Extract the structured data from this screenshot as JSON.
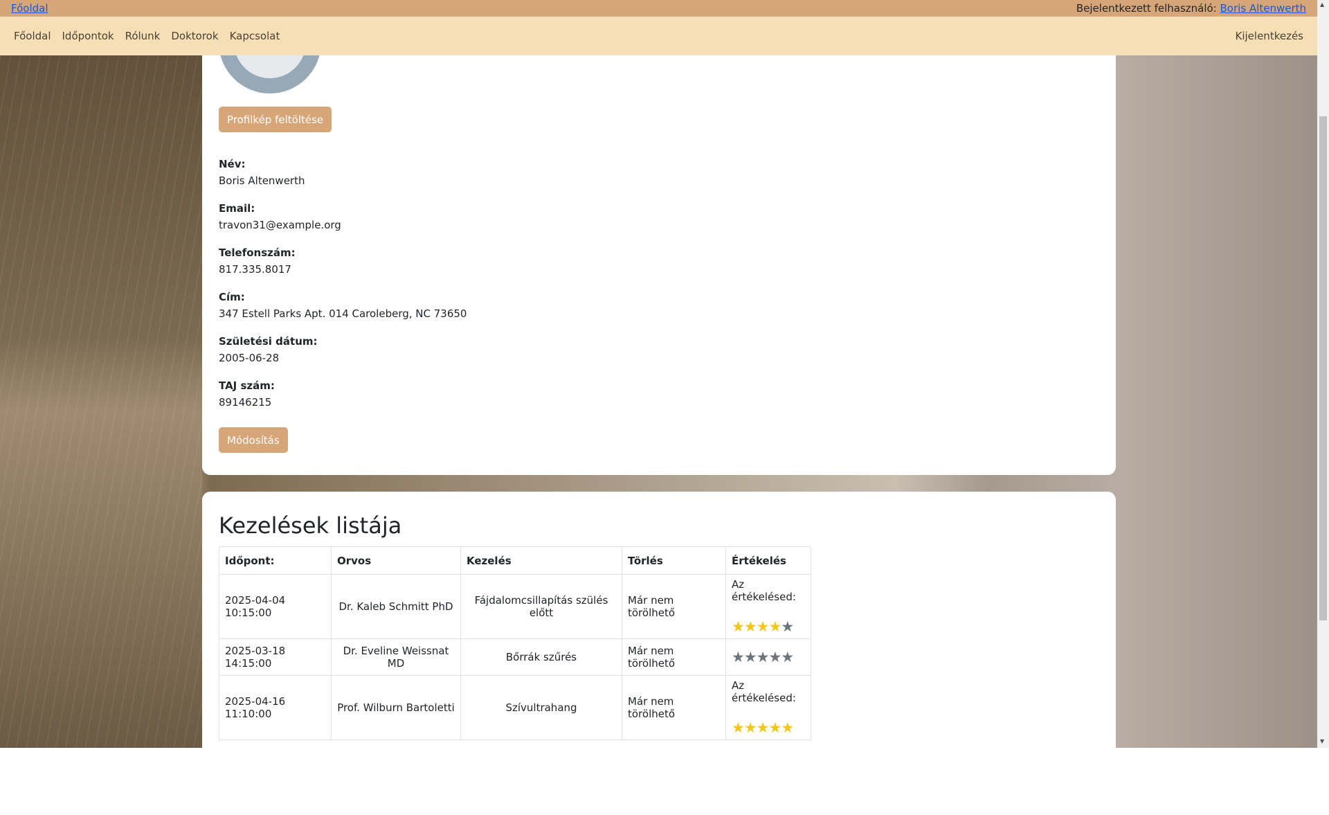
{
  "topbar": {
    "home_link": "Főoldal",
    "logged_in_label": "Bejelentkezett felhasználó:",
    "user_link": "Boris Altenwerth"
  },
  "nav": {
    "items": [
      "Főoldal",
      "Időpontok",
      "Rólunk",
      "Doktorok",
      "Kapcsolat"
    ],
    "logout": "Kijelentkezés"
  },
  "profile": {
    "upload_button": "Profilkép feltöltése",
    "fields": [
      {
        "label": "Név:",
        "value": "Boris Altenwerth"
      },
      {
        "label": "Email:",
        "value": "travon31@example.org"
      },
      {
        "label": "Telefonszám:",
        "value": "817.335.8017"
      },
      {
        "label": "Cím:",
        "value": "347 Estell Parks Apt. 014 Caroleberg, NC 73650"
      },
      {
        "label": "Születési dátum:",
        "value": "2005-06-28"
      },
      {
        "label": "TAJ szám:",
        "value": "89146215"
      }
    ],
    "edit_button": "Módosítás"
  },
  "treatments": {
    "title": "Kezelések listája",
    "columns": [
      "Időpont:",
      "Orvos",
      "Kezelés",
      "Törlés",
      "Értékelés"
    ],
    "rows": [
      {
        "date": "2025-04-04 10:15:00",
        "doctor": "Dr. Kaleb Schmitt PhD",
        "treatment": "Fájdalomcsillapítás szülés előtt",
        "delete": "Már nem törölhető",
        "rating_label": "Az értékelésed:",
        "rating": 4
      },
      {
        "date": "2025-03-18 14:15:00",
        "doctor": "Dr. Eveline Weissnat MD",
        "treatment": "Bőrrák szűrés",
        "delete": "Már nem törölhető",
        "rating_label": "",
        "rating": 0
      },
      {
        "date": "2025-04-16 11:10:00",
        "doctor": "Prof. Wilburn Bartoletti",
        "treatment": "Szívultrahang",
        "delete": "Már nem törölhető",
        "rating_label": "Az értékelésed:",
        "rating": 5
      }
    ]
  },
  "colors": {
    "topbar": "#d6a578",
    "navbar": "#f7dfb5",
    "button": "#d6a578",
    "star_on": "#f5c518",
    "star_off": "#6c757d"
  }
}
